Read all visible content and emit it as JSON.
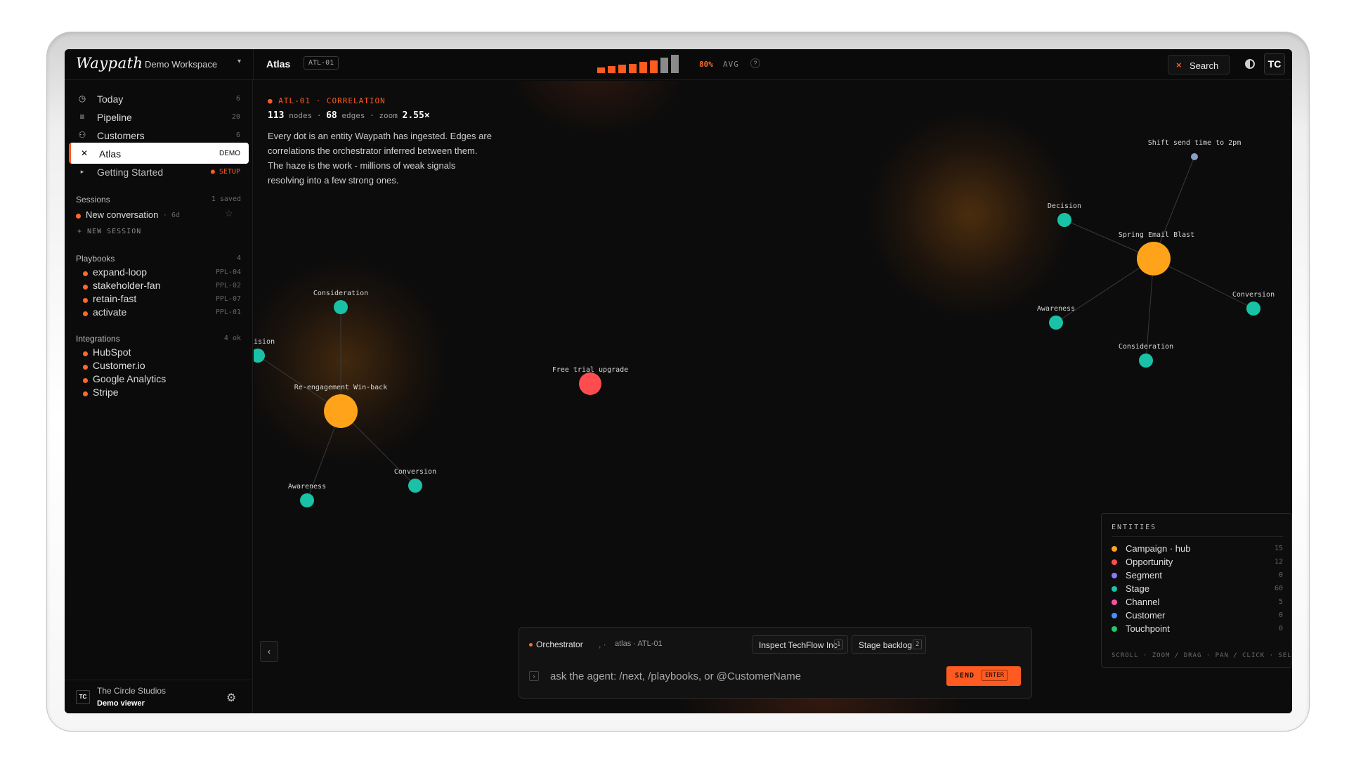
{
  "header": {
    "brand": "Waypath",
    "workspace": "Demo Workspace",
    "workspace_caret": "▾",
    "page_title": "Atlas",
    "page_code": "ATL-01",
    "meter": {
      "percent_label": "80%",
      "avg_label": "AVG",
      "help": "?",
      "bars": [
        0.3,
        0.4,
        0.45,
        0.5,
        0.6,
        0.7,
        0.85,
        1.0
      ],
      "level": 0.8
    },
    "search_label": "Search",
    "search_icon": "×",
    "avatar": "TC"
  },
  "sidebar": {
    "nav": [
      {
        "label": "Today",
        "count": "6",
        "icon": "◷"
      },
      {
        "label": "Pipeline",
        "count": "20",
        "icon": "≡"
      },
      {
        "label": "Customers",
        "count": "6",
        "icon": "⚇"
      },
      {
        "label": "Atlas",
        "count": "DEMO",
        "icon": "✕"
      },
      {
        "label": "Getting Started",
        "badge": "● SETUP",
        "icon": "▸"
      }
    ],
    "sessions": {
      "title": "Sessions",
      "count": "1 saved",
      "items": [
        {
          "label": "New conversation",
          "age": "· 6d"
        }
      ],
      "new_label": "+ NEW SESSION"
    },
    "playbooks": {
      "title": "Playbooks",
      "count": "4",
      "items": [
        {
          "label": "expand-loop",
          "code": "PPL-04"
        },
        {
          "label": "stakeholder-fan",
          "code": "PPL-02"
        },
        {
          "label": "retain-fast",
          "code": "PPL-07"
        },
        {
          "label": "activate",
          "code": "PPL-01"
        }
      ]
    },
    "integrations": {
      "title": "Integrations",
      "count": "4 ok",
      "items": [
        {
          "label": "HubSpot"
        },
        {
          "label": "Customer.io"
        },
        {
          "label": "Google Analytics"
        },
        {
          "label": "Stripe"
        }
      ]
    },
    "footer": {
      "avatar": "TC",
      "org": "The Circle Studios",
      "role": "Demo viewer"
    }
  },
  "canvas": {
    "kicker": "● ATL-01 · CORRELATION",
    "stats": {
      "nodes": "113",
      "nodes_label": "nodes",
      "sep": "·",
      "edges": "68",
      "edges_label": "edges",
      "zoom_label": "zoom",
      "zoom": "2.55×"
    },
    "intro": "Every dot is an entity Waypath has ingested. Edges are correlations the orchestrator inferred between them. The haze is the work - millions of weak signals resolving into a few strong ones.",
    "labels": {
      "shift": "Shift send time to 2pm",
      "decision_r": "Decision",
      "spring": "Spring Email Blast",
      "conversion_r": "Conversion",
      "awareness_r": "Awareness",
      "consideration_r": "Consideration",
      "consideration_l": "Consideration",
      "decision_l_partial": "ision",
      "reengage": "Re-engagement Win-back",
      "conversion_l": "Conversion",
      "awareness_l": "Awareness",
      "free_trial": "Free trial upgrade"
    }
  },
  "entities": {
    "title": "ENTITIES",
    "items": [
      {
        "label": "Campaign · hub",
        "count": "15",
        "color": "#ffa31a"
      },
      {
        "label": "Opportunity",
        "count": "12",
        "color": "#ff4d4f"
      },
      {
        "label": "Segment",
        "count": "0",
        "color": "#8b7cf6"
      },
      {
        "label": "Stage",
        "count": "60",
        "color": "#19c2a6"
      },
      {
        "label": "Channel",
        "count": "5",
        "color": "#ff4fa3"
      },
      {
        "label": "Customer",
        "count": "0",
        "color": "#4c8dff"
      },
      {
        "label": "Touchpoint",
        "count": "0",
        "color": "#1fc96a"
      }
    ],
    "hints": "SCROLL · ZOOM / DRAG · PAN / CLICK · SELECT"
  },
  "chat": {
    "agent": "Orchestrator",
    "ctx_sep": ", ·",
    "context": "atlas · ATL-01",
    "chips": [
      {
        "label": "Inspect TechFlow Inc",
        "key": "1"
      },
      {
        "label": "Stage backlog",
        "key": "2"
      }
    ],
    "prompt_icon": "›",
    "placeholder": "ask the agent: /next, /playbooks, or @CustomerName",
    "send_label": "SEND",
    "send_key": "ENTER"
  },
  "collapse_icon": "‹",
  "gear_icon": "⚙",
  "colors": {
    "accent": "#ff5a1f",
    "hub": "#ffa31a",
    "stage": "#19c2a6",
    "opportunity": "#ff4d4f",
    "signal": "#8aa0c8"
  }
}
